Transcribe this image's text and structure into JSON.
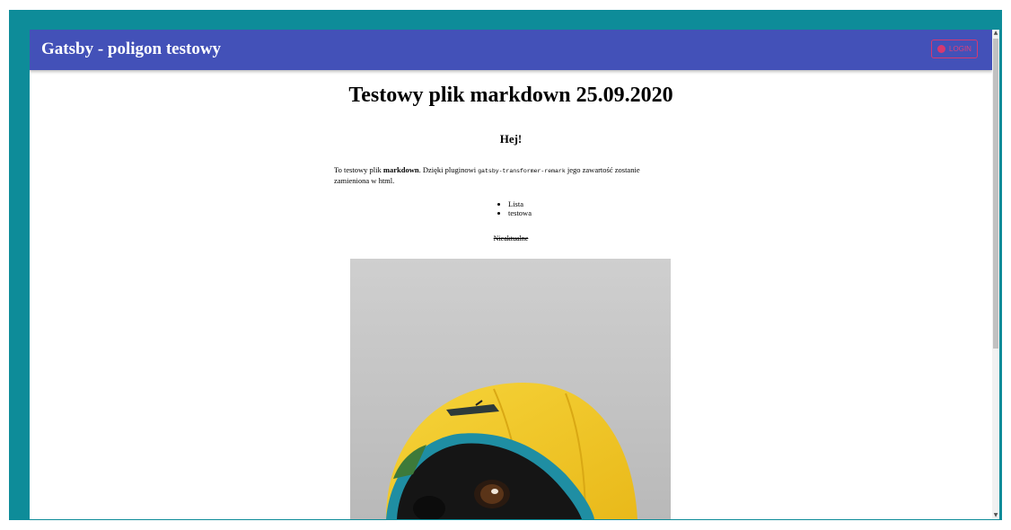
{
  "header": {
    "title": "Gatsby - poligon testowy",
    "login_label": "LOGIN"
  },
  "article": {
    "title": "Testowy plik markdown 25.09.2020",
    "greeting": "Hej!",
    "paragraph": {
      "part1": "To testowy plik ",
      "bold": "markdown",
      "part2": ". Dzięki pluginowi ",
      "code": "gatsby-transformer-remark",
      "part3": " jego zawartość zostanie zamieniona w html."
    },
    "list_items": [
      "Lista",
      "testowa"
    ],
    "strikethrough": "Nieaktualne"
  },
  "colors": {
    "frame": "#0e8c99",
    "appbar": "#4351b8",
    "accent": "#d8386f"
  }
}
